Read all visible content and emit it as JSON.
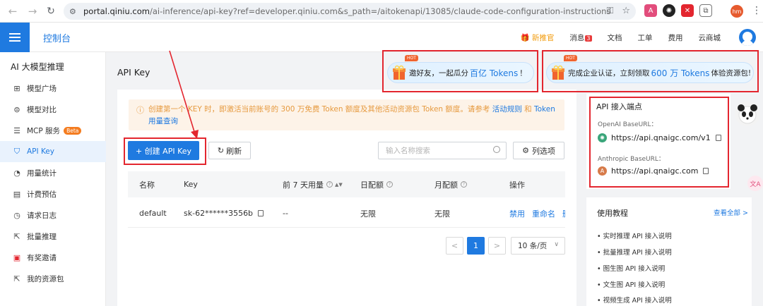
{
  "browser": {
    "url_host": "portal.qiniu.com",
    "url_path": "/ai-inference/api-key?ref=developer.qiniu.com&s_path=/aitokenapi/13085/claude-code-configuration-instructions",
    "profile_initials": "hm"
  },
  "header": {
    "console_label": "控制台",
    "links": [
      "新推官",
      "消息",
      "文档",
      "工单",
      "费用",
      "云商城"
    ],
    "message_count": "3"
  },
  "sidebar": {
    "title": "AI 大模型推理",
    "items": [
      {
        "label": "模型广场",
        "icon": "grid-icon"
      },
      {
        "label": "模型对比",
        "icon": "compare-icon"
      },
      {
        "label": "MCP 服务",
        "icon": "sliders-icon",
        "badge": "Beta"
      },
      {
        "label": "API Key",
        "icon": "shield-icon",
        "active": true
      },
      {
        "label": "用量统计",
        "icon": "pie-chart-icon"
      },
      {
        "label": "计费预估",
        "icon": "receipt-icon"
      },
      {
        "label": "请求日志",
        "icon": "log-icon"
      },
      {
        "label": "批量推理",
        "icon": "batch-icon"
      },
      {
        "label": "有奖邀请",
        "icon": "gift-icon"
      },
      {
        "label": "我的资源包",
        "icon": "package-icon"
      }
    ]
  },
  "page": {
    "title": "API Key"
  },
  "promos": {
    "invite": {
      "hot": "HOT",
      "prefix": "邀好友，一起瓜分",
      "highlight": "百亿 Tokens",
      "suffix": "！"
    },
    "enterprise": {
      "hot": "HOT",
      "prefix": "完成企业认证，立刻领取",
      "highlight": "600 万 Tokens",
      "suffix": "体验资源包!"
    }
  },
  "notice": {
    "text": "创建第一个 KEY 时，即激活当前账号的 300 万免费 Token 额度及其他活动资源包 Token 额度。请参考",
    "link1": "活动规则",
    "and": "和",
    "link2": "Token用量查询"
  },
  "toolbar": {
    "create_label": "+ 创建 API Key",
    "refresh_label": "刷新",
    "search_placeholder": "输入名称搜索",
    "columns_label": "列选项"
  },
  "table": {
    "headers": [
      "名称",
      "Key",
      "前 7 天用量",
      "日配额",
      "月配额",
      "操作"
    ],
    "rows": [
      {
        "name": "default",
        "key": "sk-62******3556b",
        "usage": "--",
        "daily": "无限",
        "monthly": "无限",
        "actions": [
          "禁用",
          "重命名",
          "删"
        ]
      }
    ]
  },
  "pagination": {
    "prev": "<",
    "current": "1",
    "next": ">",
    "page_size": "10 条/页"
  },
  "endpoints": {
    "title": "API 接入端点",
    "openai_label": "OpenAI BaseURL：",
    "openai_url": "https://api.qnaigc.com/v1",
    "anthropic_label": "Anthropic BaseURL：",
    "anthropic_url": "https://api.qnaigc.com"
  },
  "tutorials": {
    "title": "使用教程",
    "view_all": "查看全部 >",
    "items": [
      "实时推理 API 接入说明",
      "批量推理 API 接入说明",
      "图生图 API 接入说明",
      "文生图 API 接入说明",
      "视频生成 API 接入说明"
    ]
  },
  "colors": {
    "accent": "#1f7ae0",
    "annotation_red": "#e3262f",
    "notice_text": "#e69a3f"
  }
}
